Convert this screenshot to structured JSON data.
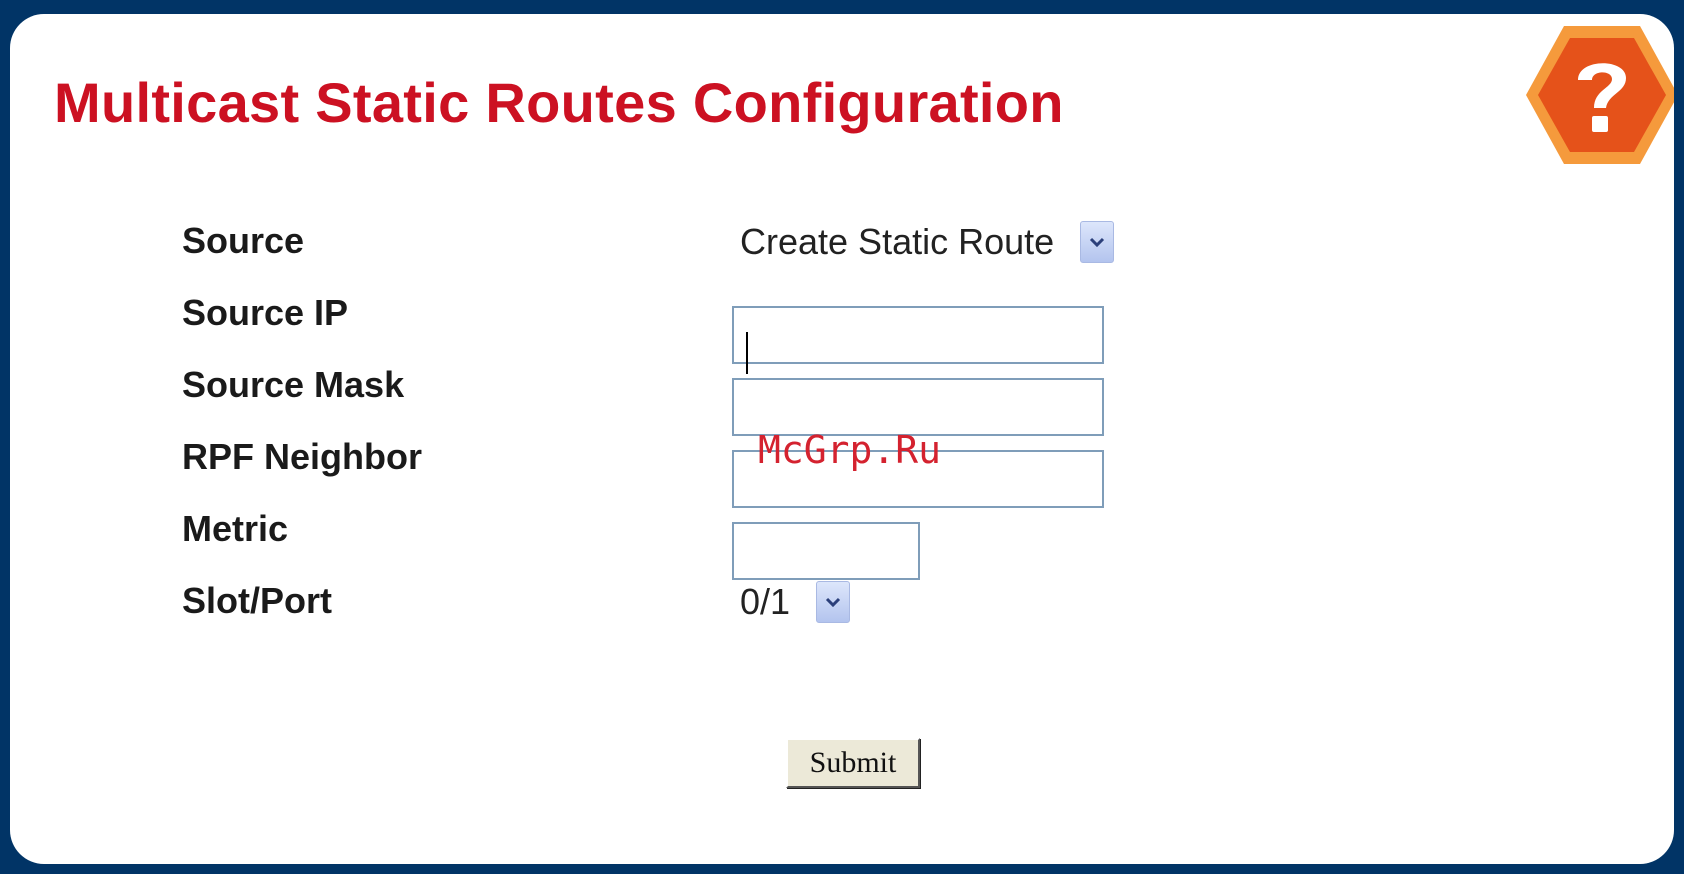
{
  "page": {
    "title": "Multicast Static Routes Configuration"
  },
  "form": {
    "source_label": "Source",
    "source_value": "Create Static Route",
    "source_ip_label": "Source IP",
    "source_ip_value": "",
    "source_mask_label": "Source Mask",
    "source_mask_value": "",
    "rpf_neighbor_label": "RPF Neighbor",
    "rpf_neighbor_value": "",
    "metric_label": "Metric",
    "metric_value": "",
    "slot_port_label": "Slot/Port",
    "slot_port_value": "0/1",
    "submit_label": "Submit"
  },
  "watermark": "McGrp.Ru",
  "icons": {
    "help": "help-question-icon",
    "dropdown": "chevron-down-icon"
  },
  "colors": {
    "background": "#013466",
    "title": "#cc1122",
    "help_outer": "#f59a3c",
    "help_inner": "#e5521a"
  }
}
